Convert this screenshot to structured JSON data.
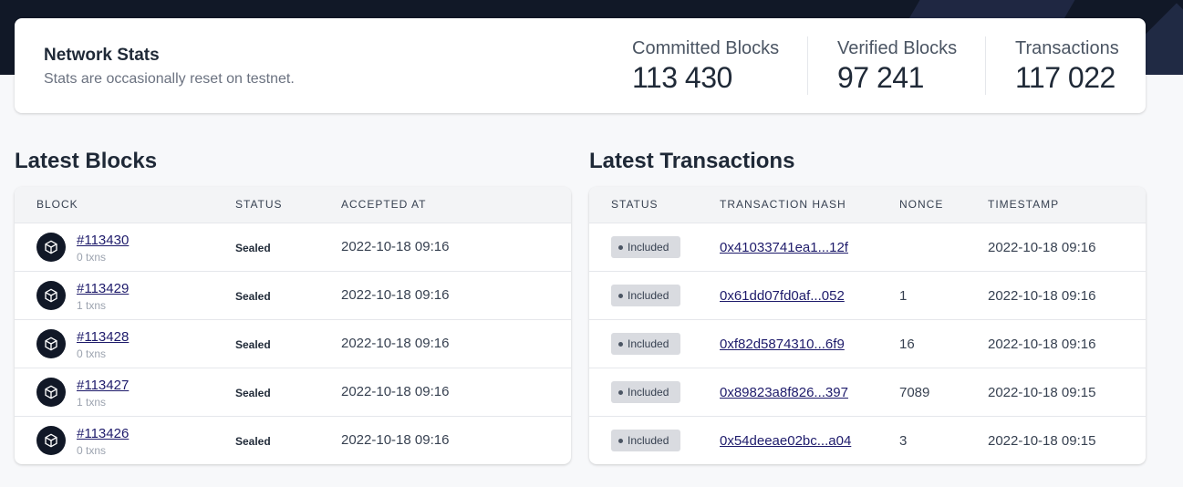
{
  "network_stats": {
    "title": "Network Stats",
    "subtitle": "Stats are occasionally reset on testnet.",
    "committed_label": "Committed Blocks",
    "committed_value": "113 430",
    "verified_label": "Verified Blocks",
    "verified_value": "97 241",
    "transactions_label": "Transactions",
    "transactions_value": "117 022"
  },
  "latest_blocks": {
    "title": "Latest Blocks",
    "columns": [
      "BLOCK",
      "STATUS",
      "ACCEPTED AT"
    ],
    "rows": [
      {
        "block": "#113430",
        "txns": "0 txns",
        "status": "Sealed",
        "accepted_at": "2022-10-18 09:16"
      },
      {
        "block": "#113429",
        "txns": "1 txns",
        "status": "Sealed",
        "accepted_at": "2022-10-18 09:16"
      },
      {
        "block": "#113428",
        "txns": "0 txns",
        "status": "Sealed",
        "accepted_at": "2022-10-18 09:16"
      },
      {
        "block": "#113427",
        "txns": "1 txns",
        "status": "Sealed",
        "accepted_at": "2022-10-18 09:16"
      },
      {
        "block": "#113426",
        "txns": "0 txns",
        "status": "Sealed",
        "accepted_at": "2022-10-18 09:16"
      }
    ]
  },
  "latest_transactions": {
    "title": "Latest Transactions",
    "columns": [
      "STATUS",
      "TRANSACTION HASH",
      "NONCE",
      "TIMESTAMP"
    ],
    "rows": [
      {
        "status": "Included",
        "hash": "0x41033741ea1...12f",
        "nonce": "",
        "timestamp": "2022-10-18 09:16"
      },
      {
        "status": "Included",
        "hash": "0x61dd07fd0af...052",
        "nonce": "1",
        "timestamp": "2022-10-18 09:16"
      },
      {
        "status": "Included",
        "hash": "0xf82d5874310...6f9",
        "nonce": "16",
        "timestamp": "2022-10-18 09:16"
      },
      {
        "status": "Included",
        "hash": "0x89823a8f826...397",
        "nonce": "7089",
        "timestamp": "2022-10-18 09:15"
      },
      {
        "status": "Included",
        "hash": "0x54deeae02bc...a04",
        "nonce": "3",
        "timestamp": "2022-10-18 09:15"
      }
    ]
  },
  "icons": {
    "block_icon": "cube-icon",
    "status_dot": "dot-icon"
  },
  "colors": {
    "header_bg": "#111827",
    "link": "#1e1b6b",
    "badge_bg": "#d9dbe0"
  }
}
